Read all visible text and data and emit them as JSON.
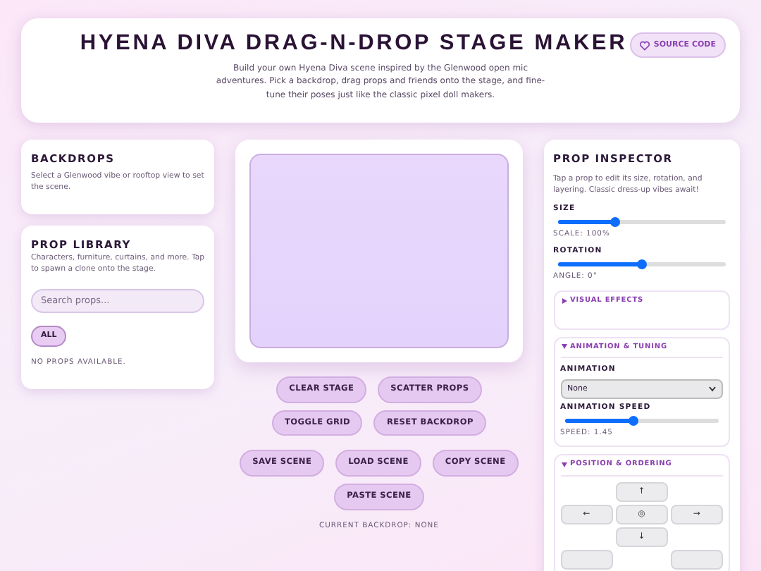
{
  "header": {
    "title": "HYENA DIVA DRAG-N-DROP STAGE MAKER",
    "subtitle": "Build your own Hyena Diva scene inspired by the Glenwood open mic adventures. Pick a backdrop, drag props and friends onto the stage, and fine-tune their poses just like the classic pixel doll makers.",
    "source_button": "SOURCE CODE"
  },
  "backdrops": {
    "title": "BACKDROPS",
    "description": "Select a Glenwood vibe or rooftop view to set the scene."
  },
  "prop_library": {
    "title": "PROP LIBRARY",
    "description": "Characters, furniture, curtains, and more. Tap to spawn a clone onto the stage.",
    "search": {
      "placeholder": "Search props..."
    },
    "filters": [
      {
        "label": "ALL",
        "selected": true
      }
    ],
    "empty_message": "NO PROPS AVAILABLE."
  },
  "stage_buttons": [
    [
      "CLEAR STAGE",
      "SCATTER PROPS"
    ],
    [
      "TOGGLE GRID",
      "RESET BACKDROP"
    ],
    [
      "SAVE SCENE",
      "LOAD SCENE",
      "COPY SCENE"
    ],
    [
      "PASTE SCENE"
    ]
  ],
  "current_backdrop": "CURRENT BACKDROP: NONE",
  "inspector": {
    "title": "PROP INSPECTOR",
    "description": "Tap a prop to edit its size, rotation, and layering. Classic dress-up vibes await!",
    "size": {
      "label": "SIZE",
      "level": 0.34,
      "reading": "SCALE: 100%"
    },
    "rotation": {
      "label": "ROTATION",
      "level": 0.5,
      "reading": "ANGLE: 0°"
    },
    "sections": [
      {
        "kind": "plain",
        "title": "VISUAL EFFECTS",
        "expanded": false
      },
      {
        "kind": "animation",
        "title": "ANIMATION & TUNING",
        "expanded": true,
        "animation_label": "ANIMATION",
        "animation_value": "None",
        "speed": {
          "label": "ANIMATION SPEED",
          "level": 0.45,
          "reading": "SPEED: 1.45"
        }
      },
      {
        "kind": "position",
        "title": "POSITION & ORDERING",
        "expanded": true,
        "pad": [
          "↑",
          "←",
          "◎",
          "→",
          "↓"
        ]
      }
    ]
  }
}
